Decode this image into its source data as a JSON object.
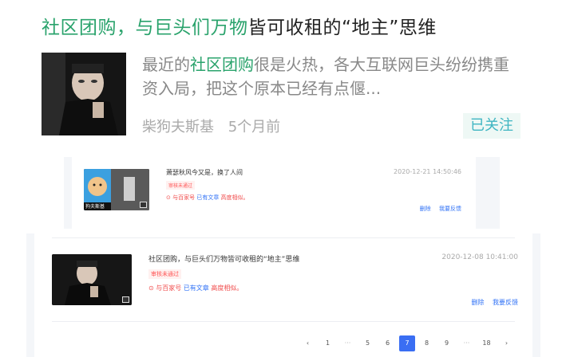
{
  "top_article": {
    "title_hl1": "社区团购，",
    "title_hl2": "与巨头们万物",
    "title_rest": "皆可收租的“地主”思维",
    "summary_pre": "最近的",
    "summary_hl": "社区团购",
    "summary_post": "很是火热，各大互联网巨头纷纷携重资入局，把这个原本已经有点偃...",
    "author": "柴狗夫斯基",
    "time_ago": "5个月前",
    "follow_label": "已关注"
  },
  "panel1": {
    "title": "萧瑟秋风今又是，换了人间",
    "date": "2020-12-21 14:50:46",
    "status_badge": "审核未通过",
    "warn_pre": "⊙ 与百家号 ",
    "warn_link": "已有文章",
    "warn_post": " 高度相似。",
    "actions": [
      "删除",
      "我要反馈"
    ],
    "thumb_caption": "狗夫斯基"
  },
  "panel2": {
    "title": "社区团购，与巨头们万物皆可收租的“地主”思维",
    "date": "2020-12-08 10:41:00",
    "status_badge": "审核未通过",
    "warn_pre": "⊙ 与百家号 ",
    "warn_link": "已有文章",
    "warn_post": " 高度相似。",
    "actions": [
      "删除",
      "我要反馈"
    ]
  },
  "pagination": {
    "prev": "‹",
    "items": [
      "1",
      "···",
      "5",
      "6",
      "7",
      "8",
      "9",
      "···",
      "18"
    ],
    "active": "7",
    "next": "›"
  },
  "colors": {
    "highlight": "#2aa36c",
    "link": "#3072f6",
    "error": "#f04b4b",
    "active_page": "#3a6ef3"
  }
}
